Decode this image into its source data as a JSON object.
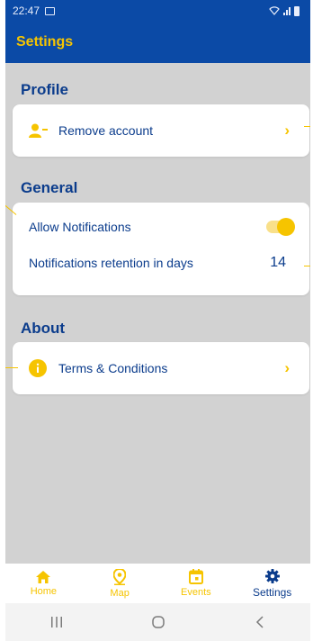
{
  "status_bar": {
    "time": "22:47"
  },
  "app_bar": {
    "title": "Settings"
  },
  "sections": {
    "profile": {
      "title": "Profile",
      "items": [
        {
          "label": "Remove account",
          "icon": "user-remove-icon"
        }
      ]
    },
    "general": {
      "title": "General",
      "allow_notifications": {
        "label": "Allow Notifications",
        "enabled": true
      },
      "retention": {
        "label": "Notifications retention in days",
        "value": "14"
      }
    },
    "about": {
      "title": "About",
      "items": [
        {
          "label": "Terms & Conditions",
          "icon": "info-icon"
        }
      ]
    }
  },
  "bottom_nav": {
    "items": [
      {
        "label": "Home",
        "icon": "home-icon"
      },
      {
        "label": "Map",
        "icon": "map-pin-icon"
      },
      {
        "label": "Events",
        "icon": "calendar-icon"
      },
      {
        "label": "Settings",
        "icon": "gear-icon",
        "active": true
      }
    ]
  },
  "colors": {
    "primary": "#0b4aa6",
    "accent": "#f6c400",
    "text": "#0b3c8c",
    "background": "#d2d2d2"
  }
}
